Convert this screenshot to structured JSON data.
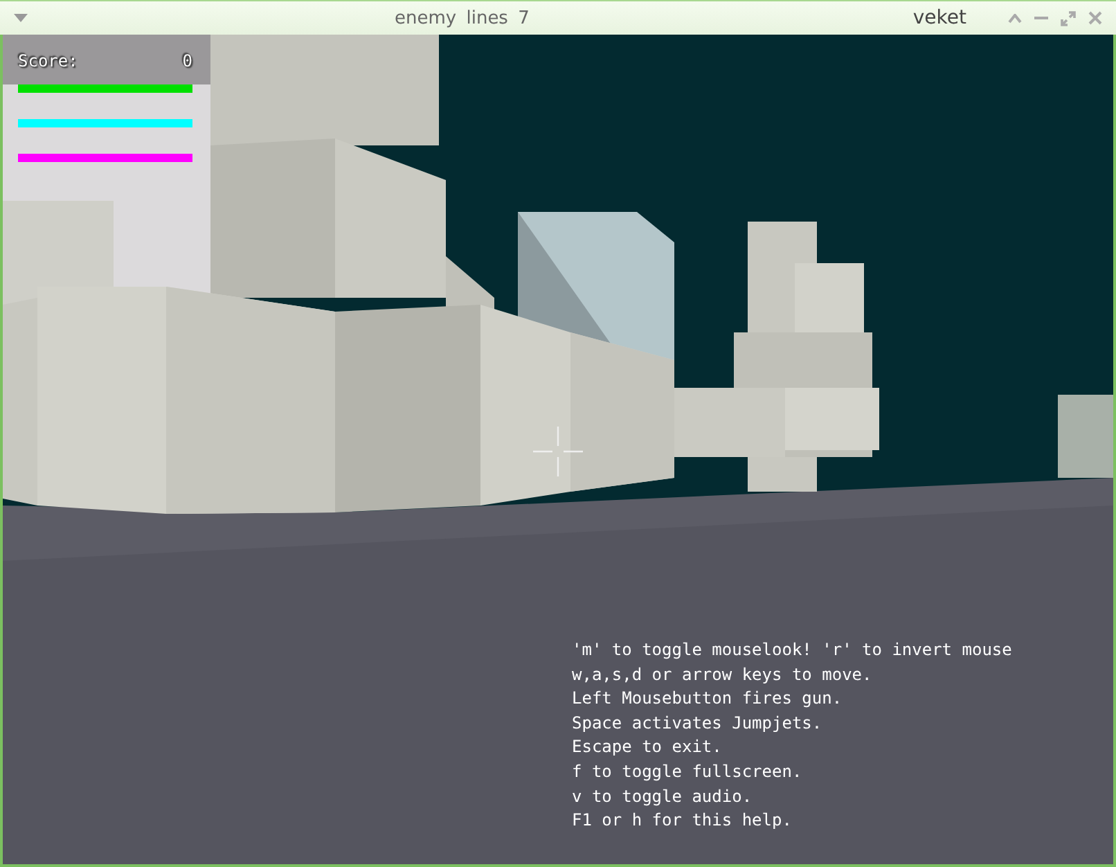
{
  "window": {
    "title": "enemy lines 7",
    "workspace": "veket"
  },
  "hud": {
    "score_label": "Score:",
    "score": "0",
    "bars": [
      {
        "level": 1,
        "color": "#00e000"
      },
      {
        "level": 1,
        "color": "#00ffff"
      },
      {
        "level": 1,
        "color": "#ff00ff"
      }
    ]
  },
  "help_lines": [
    "'m' to toggle mouselook! 'r' to invert mouse",
    "w,a,s,d or arrow keys to move.",
    "Left Mousebutton fires gun.",
    "Space activates Jumpjets.",
    "Escape to exit.",
    "f to toggle fullscreen.",
    "v to toggle audio.",
    "F1 or h for this help."
  ]
}
